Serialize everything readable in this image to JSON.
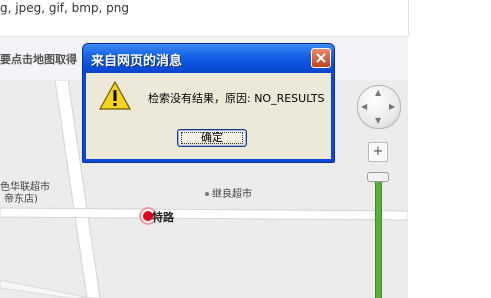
{
  "page": {
    "formats_text": "g, jpeg, gif, bmp, png",
    "map_hint": "要点击地图取得"
  },
  "map": {
    "pois": [
      {
        "label": "继良超市"
      },
      {
        "label": "色华联超市"
      },
      {
        "label": "帝东店)"
      }
    ],
    "road_label": "特路"
  },
  "controls": {
    "zoom_in": "+",
    "nav_arrows": {
      "up": "▲",
      "down": "▼",
      "left": "◀",
      "right": "▶"
    }
  },
  "dialog": {
    "title": "来自网页的消息",
    "message": "检索没有结果，原因: NO_RESULTS",
    "ok_label": "确定",
    "icon": "warning-icon",
    "close_icon": "close-icon"
  },
  "colors": {
    "titlebar": "#0b4fdd",
    "dialog_body": "#ece9d8",
    "close_button": "#c3431f",
    "zoom_track": "#5cae3b",
    "marker": "#e0001a"
  }
}
